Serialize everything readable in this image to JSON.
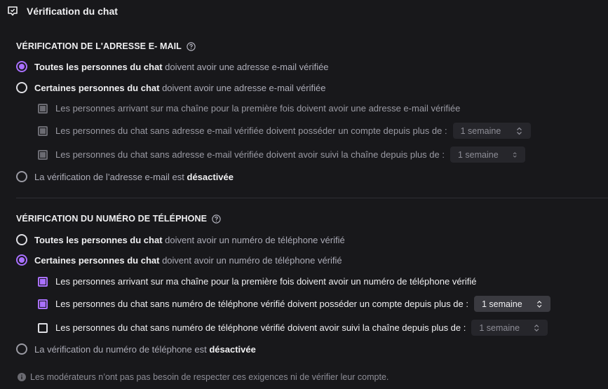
{
  "header": {
    "title": "Vérification du chat",
    "icon": "chat-shield-icon"
  },
  "email": {
    "title": "VÉRIFICATION DE L'ADRESSE E- MAIL",
    "opt_all_bold": "Toutes les personnes du chat",
    "opt_all_rest": " doivent avoir une adresse e-mail vérifiée",
    "opt_some_bold": "Certaines personnes du chat",
    "opt_some_rest": " doivent avoir une adresse e-mail vérifiée",
    "check_first": "Les personnes arrivant sur ma chaîne pour la première fois doivent avoir une adresse e-mail vérifiée",
    "check_age": "Les personnes du chat sans adresse e-mail vérifiée doivent posséder un compte depuis plus de :",
    "check_age_value": "1 semaine",
    "check_follow": "Les personnes du chat sans adresse e-mail vérifiée doivent avoir suivi la chaîne depuis plus de :",
    "check_follow_value": "1 semaine",
    "opt_off_rest": "La vérification de l’adresse e-mail est ",
    "opt_off_bold": "désactivée",
    "selected": "all"
  },
  "phone": {
    "title": "VÉRIFICATION DU NUMÉRO DE TÉLÉPHONE",
    "opt_all_bold": "Toutes les personnes du chat",
    "opt_all_rest": " doivent avoir un numéro de téléphone vérifié",
    "opt_some_bold": "Certaines personnes du chat",
    "opt_some_rest": " doivent avoir un numéro de téléphone vérifié",
    "check_first": "Les personnes arrivant sur ma chaîne pour la première fois doivent avoir un numéro de téléphone vérifié",
    "check_age": "Les personnes du chat sans numéro de téléphone vérifié doivent posséder un compte depuis plus de :",
    "check_age_value": "1 semaine",
    "check_follow": "Les personnes du chat sans numéro de téléphone vérifié doivent avoir suivi la chaîne depuis plus de :",
    "check_follow_value": "1 semaine",
    "opt_off_rest": "La vérification du numéro de téléphone est ",
    "opt_off_bold": "désactivée",
    "selected": "some",
    "checks": {
      "first": true,
      "age": true,
      "follow": false
    }
  },
  "footer": {
    "note": "Les modérateurs n’ont pas pas besoin de respecter ces exigences ni de vérifier leur compte."
  },
  "colors": {
    "accent": "#a970ff",
    "background": "#18181b"
  }
}
